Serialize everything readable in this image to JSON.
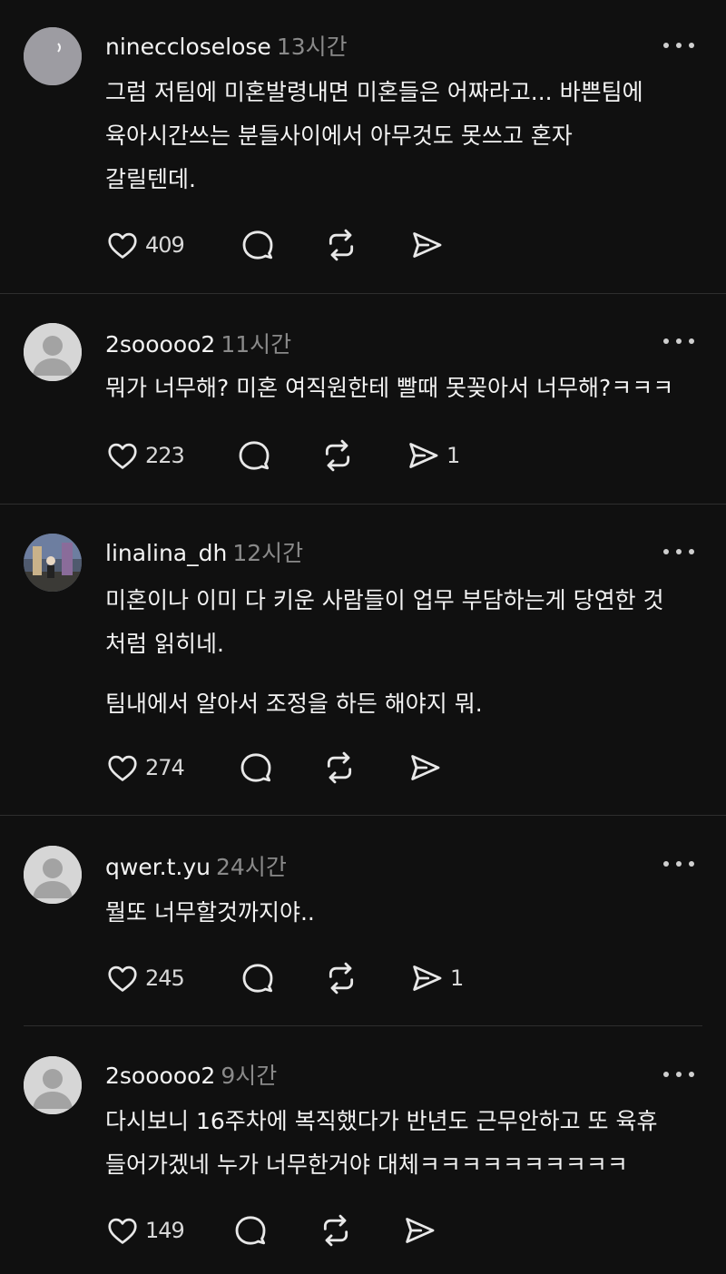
{
  "posts": [
    {
      "username": "nineccloselose",
      "time": "13시간",
      "lines": [
        "그럼 저팀에 미혼발령내면 미혼들은 어짜라고... 바쁜팀에",
        "육아시간쓰는 분들사이에서 아무것도  못쓰고 혼자",
        "갈릴텐데."
      ],
      "likes": "409",
      "shares": ""
    },
    {
      "username": "2sooooo2",
      "time": "11시간",
      "lines": [
        "뭐가 너무해? 미혼 여직원한테 빨때 못꽂아서 너무해?ㅋㅋㅋ"
      ],
      "likes": "223",
      "shares": "1"
    },
    {
      "username": "linalina_dh",
      "time": "12시간",
      "lines": [
        "미혼이나 이미 다 키운 사람들이 업무 부담하는게 당연한 것",
        "처럼 읽히네.",
        "팀내에서 알아서 조정을 하든 해야지 뭐."
      ],
      "likes": "274",
      "shares": ""
    },
    {
      "username": "qwer.t.yu",
      "time": "24시간",
      "lines": [
        "뭘또 너무할것까지야.."
      ],
      "likes": "245",
      "shares": "1"
    },
    {
      "username": "2sooooo2",
      "time": "9시간",
      "lines": [
        "다시보니 16주차에 복직했다가 반년도 근무안하고 또 육휴",
        "들어가겠네 누가 너무한거야 대체ㅋㅋㅋㅋㅋㅋㅋㅋㅋㅋ"
      ],
      "likes": "149",
      "shares": ""
    }
  ],
  "icons": {
    "like": "heart-icon",
    "reply": "speech-bubble-icon",
    "repost": "repost-arrows-icon",
    "share": "paper-plane-icon",
    "more": "ellipsis-icon"
  },
  "colors": {
    "background": "#101010",
    "text": "#f3f3f3",
    "muted": "#8a8a8a",
    "divider": "#2e2e2e"
  }
}
